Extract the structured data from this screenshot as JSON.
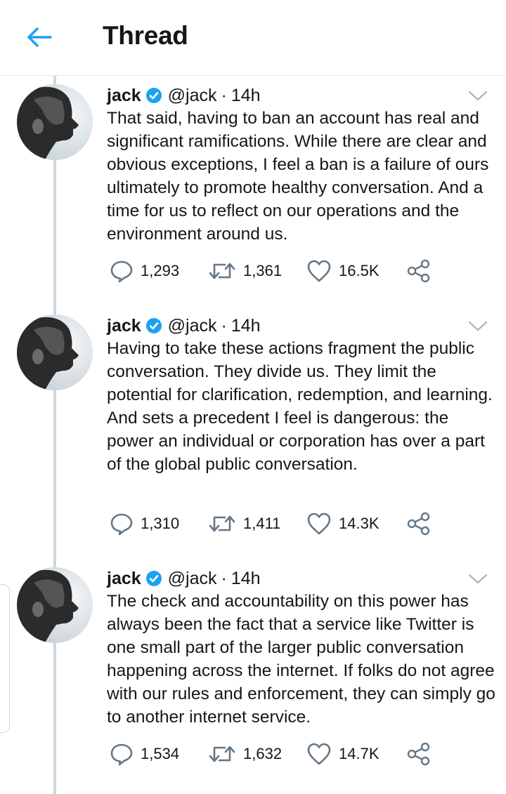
{
  "header": {
    "title": "Thread",
    "back_icon": "arrow-left-icon"
  },
  "colors": {
    "accent": "#1da1f2",
    "text": "#14171a",
    "thread_line": "#ccd6dd",
    "icon_gray": "#657786"
  },
  "tweets": [
    {
      "name": "jack",
      "handle": "@jack",
      "time": "14h",
      "text": "That said, having to ban an account has real and significant ramifications. While there are clear and obvious exceptions, I feel a ban is a failure of ours ultimately to promote healthy conversation. And a time for us to reflect on our operations and the environment around us.",
      "replies": "1,293",
      "retweets": "1,361",
      "likes": "16.5K"
    },
    {
      "name": "jack",
      "handle": "@jack",
      "time": "14h",
      "text": "Having to take these actions fragment the public conversation. They divide us. They limit the potential for clarification, redemption, and learning. And sets a precedent I feel is dangerous: the power an individual or corporation has over a part of the global public conversation.",
      "replies": "1,310",
      "retweets": "1,411",
      "likes": "14.3K"
    },
    {
      "name": "jack",
      "handle": "@jack",
      "time": "14h",
      "text": "The check and accountability on this power has always been the fact that a service like Twitter is one small part of the larger public conversation happening across the internet. If folks do not agree with our rules and enforcement, they can simply go to another internet service.",
      "replies": "1,534",
      "retweets": "1,632",
      "likes": "14.7K"
    }
  ]
}
